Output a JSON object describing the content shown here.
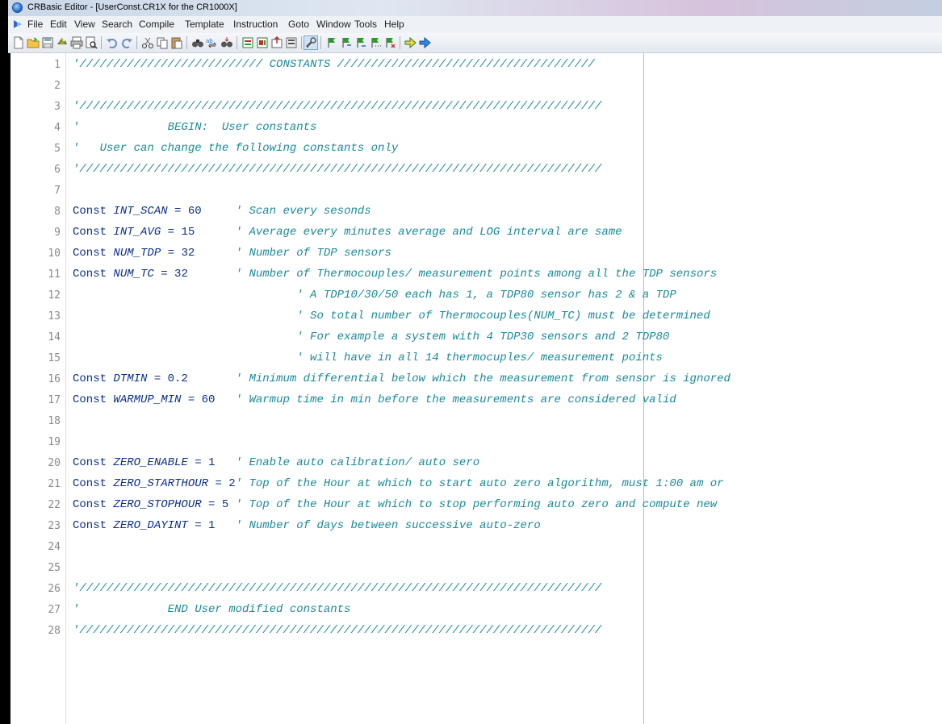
{
  "window": {
    "title": "CRBasic Editor - [UserConst.CR1X for the CR1000X]"
  },
  "menu": [
    "File",
    "Edit",
    "View",
    "Search",
    "Compile",
    "Template",
    "Instruction",
    "Goto",
    "Window",
    "Tools",
    "Help"
  ],
  "toolbar_icons": [
    "new-file-icon",
    "open-folder-icon",
    "save-icon",
    "save-all-icon",
    "print-icon",
    "print-preview-icon",
    "undo-icon",
    "redo-icon",
    "cut-icon",
    "copy-icon",
    "paste-icon",
    "find-icon",
    "replace-icon",
    "find-next-icon",
    "compile-icon",
    "compile-save-icon",
    "send-program-icon",
    "check-icon",
    "wrench-icon",
    "bookmark-toggle-icon",
    "bookmark-next-icon",
    "bookmark-prev-icon",
    "bookmark-list-icon",
    "bookmark-clear-icon",
    "go-back-icon",
    "go-forward-icon"
  ],
  "colors": {
    "keyword": "#0b2f8e",
    "comment": "#198a9a",
    "line_number": "#8a8a8a"
  },
  "code": [
    {
      "n": "1",
      "kw": "",
      "var": "",
      "val": "",
      "cm": "'/////////////////////////// CONSTANTS //////////////////////////////////////"
    },
    {
      "n": "2",
      "kw": "",
      "var": "",
      "val": "",
      "cm": ""
    },
    {
      "n": "3",
      "kw": "",
      "var": "",
      "val": "",
      "cm": "'/////////////////////////////////////////////////////////////////////////////"
    },
    {
      "n": "4",
      "kw": "",
      "var": "",
      "val": "",
      "cm": "'             BEGIN:  User constants"
    },
    {
      "n": "5",
      "kw": "",
      "var": "",
      "val": "",
      "cm": "'   User can change the following constants only"
    },
    {
      "n": "6",
      "kw": "",
      "var": "",
      "val": "",
      "cm": "'/////////////////////////////////////////////////////////////////////////////"
    },
    {
      "n": "7",
      "kw": "",
      "var": "",
      "val": "",
      "cm": ""
    },
    {
      "n": "8",
      "kw": "Const ",
      "var": "INT_SCAN",
      "val": " = 60     ",
      "cm": "' Scan every sesonds"
    },
    {
      "n": "9",
      "kw": "Const ",
      "var": "INT_AVG",
      "val": " = 15      ",
      "cm": "' Average every minutes average and LOG interval are same"
    },
    {
      "n": "10",
      "kw": "Const ",
      "var": "NUM_TDP",
      "val": " = 32      ",
      "cm": "' Number of TDP sensors"
    },
    {
      "n": "11",
      "kw": "Const ",
      "var": "NUM_TC",
      "val": " = 32       ",
      "cm": "' Number of Thermocouples/ measurement points among all the TDP sensors"
    },
    {
      "n": "12",
      "kw": "",
      "var": "",
      "val": "",
      "cm": "                                 ' A TDP10/30/50 each has 1, a TDP80 sensor has 2 & a TDP"
    },
    {
      "n": "13",
      "kw": "",
      "var": "",
      "val": "",
      "cm": "                                 ' So total number of Thermocouples(NUM_TC) must be determined"
    },
    {
      "n": "14",
      "kw": "",
      "var": "",
      "val": "",
      "cm": "                                 ' For example a system with 4 TDP30 sensors and 2 TDP80"
    },
    {
      "n": "15",
      "kw": "",
      "var": "",
      "val": "",
      "cm": "                                 ' will have in all 14 thermocuples/ measurement points"
    },
    {
      "n": "16",
      "kw": "Const ",
      "var": "DTMIN",
      "val": " = 0.2       ",
      "cm": "' Minimum differential below which the measurement from sensor is ignored"
    },
    {
      "n": "17",
      "kw": "Const ",
      "var": "WARMUP_MIN",
      "val": " = 60   ",
      "cm": "' Warmup time in min before the measurements are considered valid"
    },
    {
      "n": "18",
      "kw": "",
      "var": "",
      "val": "",
      "cm": ""
    },
    {
      "n": "19",
      "kw": "",
      "var": "",
      "val": "",
      "cm": ""
    },
    {
      "n": "20",
      "kw": "Const ",
      "var": "ZERO_ENABLE",
      "val": " = 1   ",
      "cm": "' Enable auto calibration/ auto sero"
    },
    {
      "n": "21",
      "kw": "Const ",
      "var": "ZERO_STARTHOUR",
      "val": " = 2",
      "cm": "' Top of the Hour at which to start auto zero algorithm, must 1:00 am or"
    },
    {
      "n": "22",
      "kw": "Const ",
      "var": "ZERO_STOPHOUR",
      "val": " = 5 ",
      "cm": "' Top of the Hour at which to stop performing auto zero and compute new"
    },
    {
      "n": "23",
      "kw": "Const ",
      "var": "ZERO_DAYINT",
      "val": " = 1   ",
      "cm": "' Number of days between successive auto-zero"
    },
    {
      "n": "24",
      "kw": "",
      "var": "",
      "val": "",
      "cm": ""
    },
    {
      "n": "25",
      "kw": "",
      "var": "",
      "val": "",
      "cm": ""
    },
    {
      "n": "26",
      "kw": "",
      "var": "",
      "val": "",
      "cm": "'/////////////////////////////////////////////////////////////////////////////"
    },
    {
      "n": "27",
      "kw": "",
      "var": "",
      "val": "",
      "cm": "'             END User modified constants"
    },
    {
      "n": "28",
      "kw": "",
      "var": "",
      "val": "",
      "cm": "'/////////////////////////////////////////////////////////////////////////////"
    }
  ]
}
